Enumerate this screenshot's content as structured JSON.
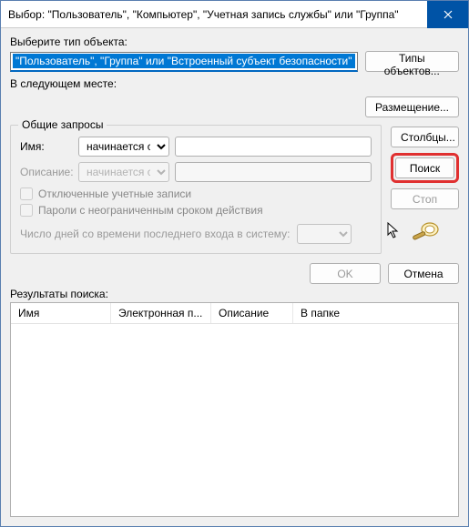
{
  "title": "Выбор: \"Пользователь\", \"Компьютер\", \"Учетная запись службы\" или \"Группа\"",
  "objtype": {
    "label": "Выберите тип объекта:",
    "value": "\"Пользователь\", \"Группа\" или \"Встроенный субъект безопасности\"",
    "button": "Типы объектов..."
  },
  "location": {
    "label": "В следующем месте:",
    "button": "Размещение..."
  },
  "queries": {
    "legend": "Общие запросы",
    "name_label": "Имя:",
    "desc_label": "Описание:",
    "combo_value": "начинается с",
    "chk_disabled": "Отключенные учетные записи",
    "chk_pwd": "Пароли с неограниченным сроком действия",
    "days_label": "Число дней со времени последнего входа в систему:"
  },
  "side": {
    "columns": "Столбцы...",
    "search": "Поиск",
    "stop": "Стоп"
  },
  "actions": {
    "ok": "OK",
    "cancel": "Отмена"
  },
  "results": {
    "label": "Результаты поиска:",
    "cols": [
      "Имя",
      "Электронная п...",
      "Описание",
      "В папке"
    ]
  }
}
